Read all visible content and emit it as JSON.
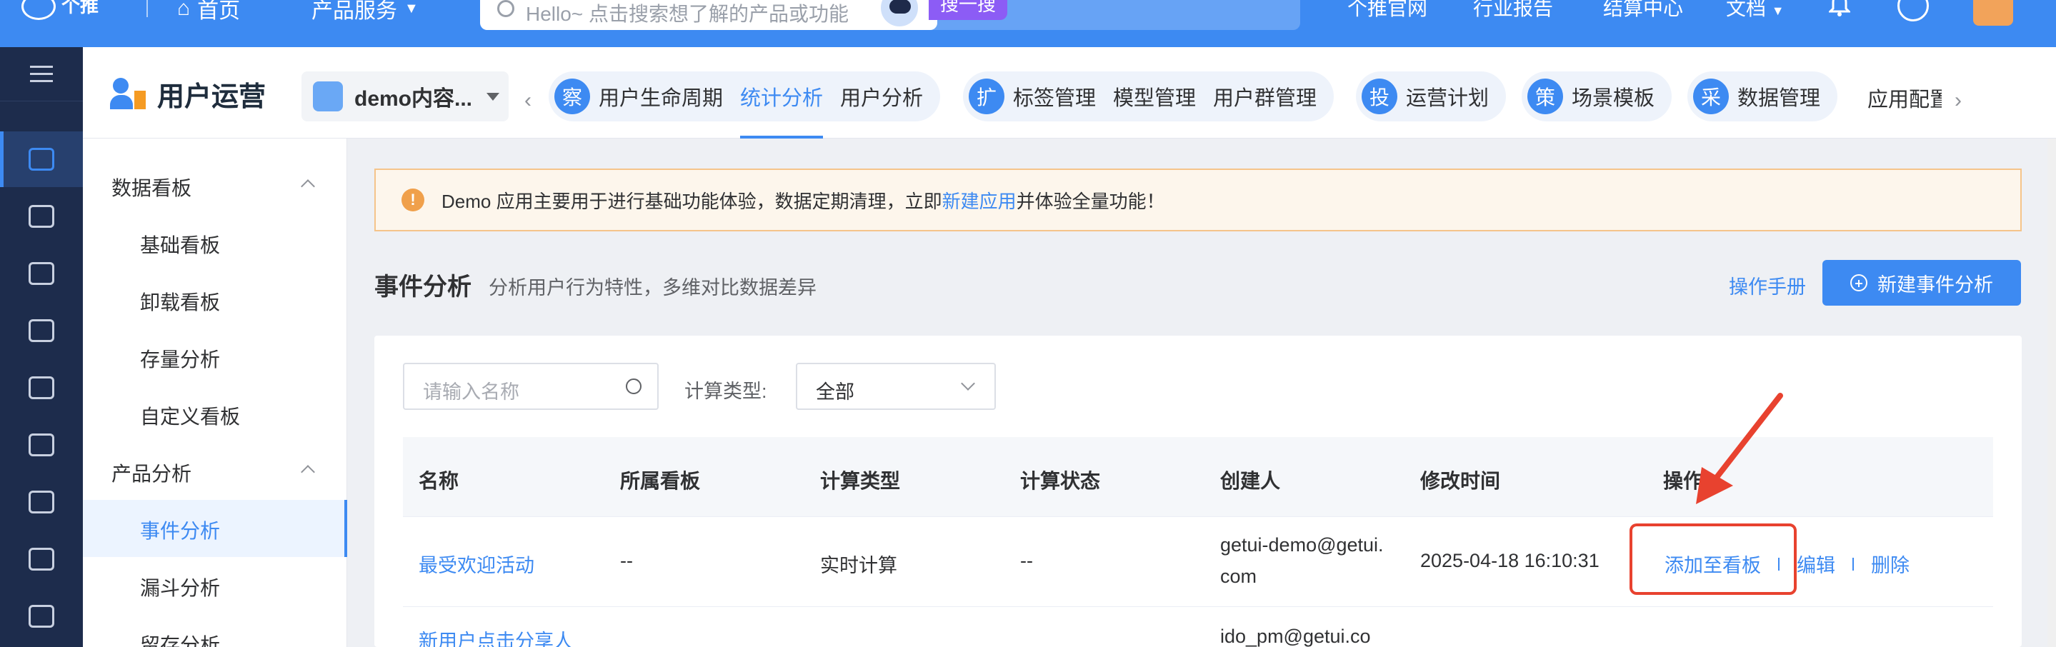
{
  "topbar": {
    "logo_text": "个推",
    "home": "首页",
    "products": "产品服务",
    "search_placeholder": "Hello~ 点击搜索想了解的产品或功能",
    "search_button": "搜一搜",
    "links": [
      "个推官网",
      "行业报告",
      "结算中心",
      "文档"
    ]
  },
  "header": {
    "title": "用户运营",
    "app_select": "demo内容...",
    "nav": {
      "group1": {
        "badge": "察",
        "items": [
          "用户生命周期",
          "统计分析",
          "用户分析"
        ],
        "active": "统计分析"
      },
      "group2": {
        "badge": "扩",
        "items": [
          "标签管理",
          "模型管理",
          "用户群管理"
        ]
      },
      "group3": {
        "badge": "投",
        "items": [
          "运营计划"
        ]
      },
      "group4": {
        "badge": "策",
        "items": [
          "场景模板"
        ]
      },
      "group5": {
        "badge": "采",
        "items": [
          "数据管理"
        ]
      },
      "overflow": "应用配置"
    }
  },
  "leftmenu": {
    "group1": "数据看板",
    "group1_items": [
      "基础看板",
      "卸载看板",
      "存量分析",
      "自定义看板"
    ],
    "group2": "产品分析",
    "group2_items": [
      "事件分析",
      "漏斗分析",
      "留存分析"
    ],
    "active": "事件分析"
  },
  "alert": {
    "icon": "!",
    "text_before": "Demo 应用主要用于进行基础功能体验，数据定期清理，立即",
    "link": "新建应用",
    "text_after": "并体验全量功能！"
  },
  "page": {
    "title": "事件分析",
    "subtitle": "分析用户行为特性，多维对比数据差异",
    "manual": "操作手册",
    "new_button": "新建事件分析"
  },
  "filters": {
    "name_placeholder": "请输入名称",
    "calc_label": "计算类型:",
    "calc_value": "全部"
  },
  "table": {
    "columns": [
      "名称",
      "所属看板",
      "计算类型",
      "计算状态",
      "创建人",
      "修改时间",
      "操作"
    ],
    "rows": [
      {
        "name": "最受欢迎活动",
        "board": "--",
        "calc_type": "实时计算",
        "calc_status": "--",
        "creator_line1": "getui-demo@getui.",
        "creator_line2": "com",
        "modified": "2025-04-18 16:10:31",
        "ops": [
          "添加至看板",
          "编辑",
          "删除"
        ]
      },
      {
        "name": "新用户点击分享人",
        "creator_line1": "ido_pm@getui.co"
      }
    ]
  },
  "colors": {
    "primary": "#3d8af2",
    "sidebar": "#1d2c4c",
    "warning_bg": "#fdf6ec",
    "annotation_red": "#e8422f"
  }
}
